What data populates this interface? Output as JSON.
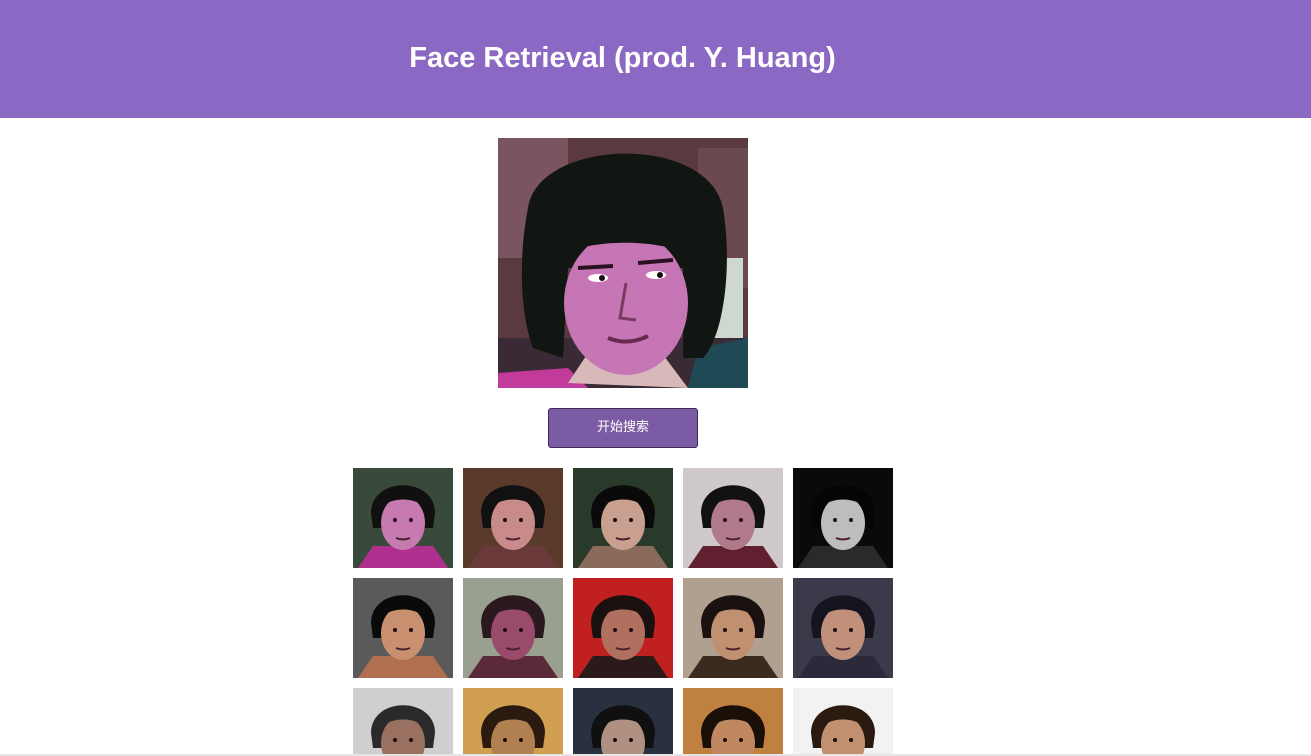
{
  "header": {
    "title": "Face Retrieval (prod. Y. Huang)",
    "background_color": "#8b68c3"
  },
  "query": {
    "image_icon": "portrait-photo"
  },
  "search": {
    "button_label": "开始搜索",
    "button_color": "#7b5ba3"
  },
  "results": {
    "columns": 5,
    "items": [
      {
        "bg": "#3a4a3a",
        "hair": "#101010",
        "skin": "#c77ab0",
        "shirt": "#b03090"
      },
      {
        "bg": "#5a3a2a",
        "hair": "#111111",
        "skin": "#c98a8a",
        "shirt": "#6a3a3a"
      },
      {
        "bg": "#2a3a2a",
        "hair": "#0a0a0a",
        "skin": "#c9a090",
        "shirt": "#8a6a5a"
      },
      {
        "bg": "#cfc9cc",
        "hair": "#111111",
        "skin": "#b07a8a",
        "shirt": "#602030"
      },
      {
        "bg": "#0a0a0a",
        "hair": "#050505",
        "skin": "#bdbdbd",
        "shirt": "#2a2a2a"
      },
      {
        "bg": "#5a5a5a",
        "hair": "#0a0a0a",
        "skin": "#c99070",
        "shirt": "#b07050"
      },
      {
        "bg": "#9aa090",
        "hair": "#2a1a20",
        "skin": "#9a4a6a",
        "shirt": "#5a2a3a"
      },
      {
        "bg": "#c02020",
        "hair": "#1a1010",
        "skin": "#b07060",
        "shirt": "#2a1a1a"
      },
      {
        "bg": "#b0a090",
        "hair": "#1a1210",
        "skin": "#c09070",
        "shirt": "#3a2a20"
      },
      {
        "bg": "#3a3a4a",
        "hair": "#151520",
        "skin": "#c0907a",
        "shirt": "#2a2a3a"
      },
      {
        "bg": "#cfcfcf",
        "hair": "#2a2a2a",
        "skin": "#9a7060",
        "shirt": "#4a4a4a"
      },
      {
        "bg": "#d0a050",
        "hair": "#2a1a10",
        "skin": "#b08050",
        "shirt": "#6a4a2a"
      },
      {
        "bg": "#2a3040",
        "hair": "#101010",
        "skin": "#b09080",
        "shirt": "#2a2a30"
      },
      {
        "bg": "#c08040",
        "hair": "#1a1008",
        "skin": "#c08860",
        "shirt": "#4a3020"
      },
      {
        "bg": "#f2f2f2",
        "hair": "#2a1a10",
        "skin": "#c09070",
        "shirt": "#ffffff"
      }
    ]
  }
}
